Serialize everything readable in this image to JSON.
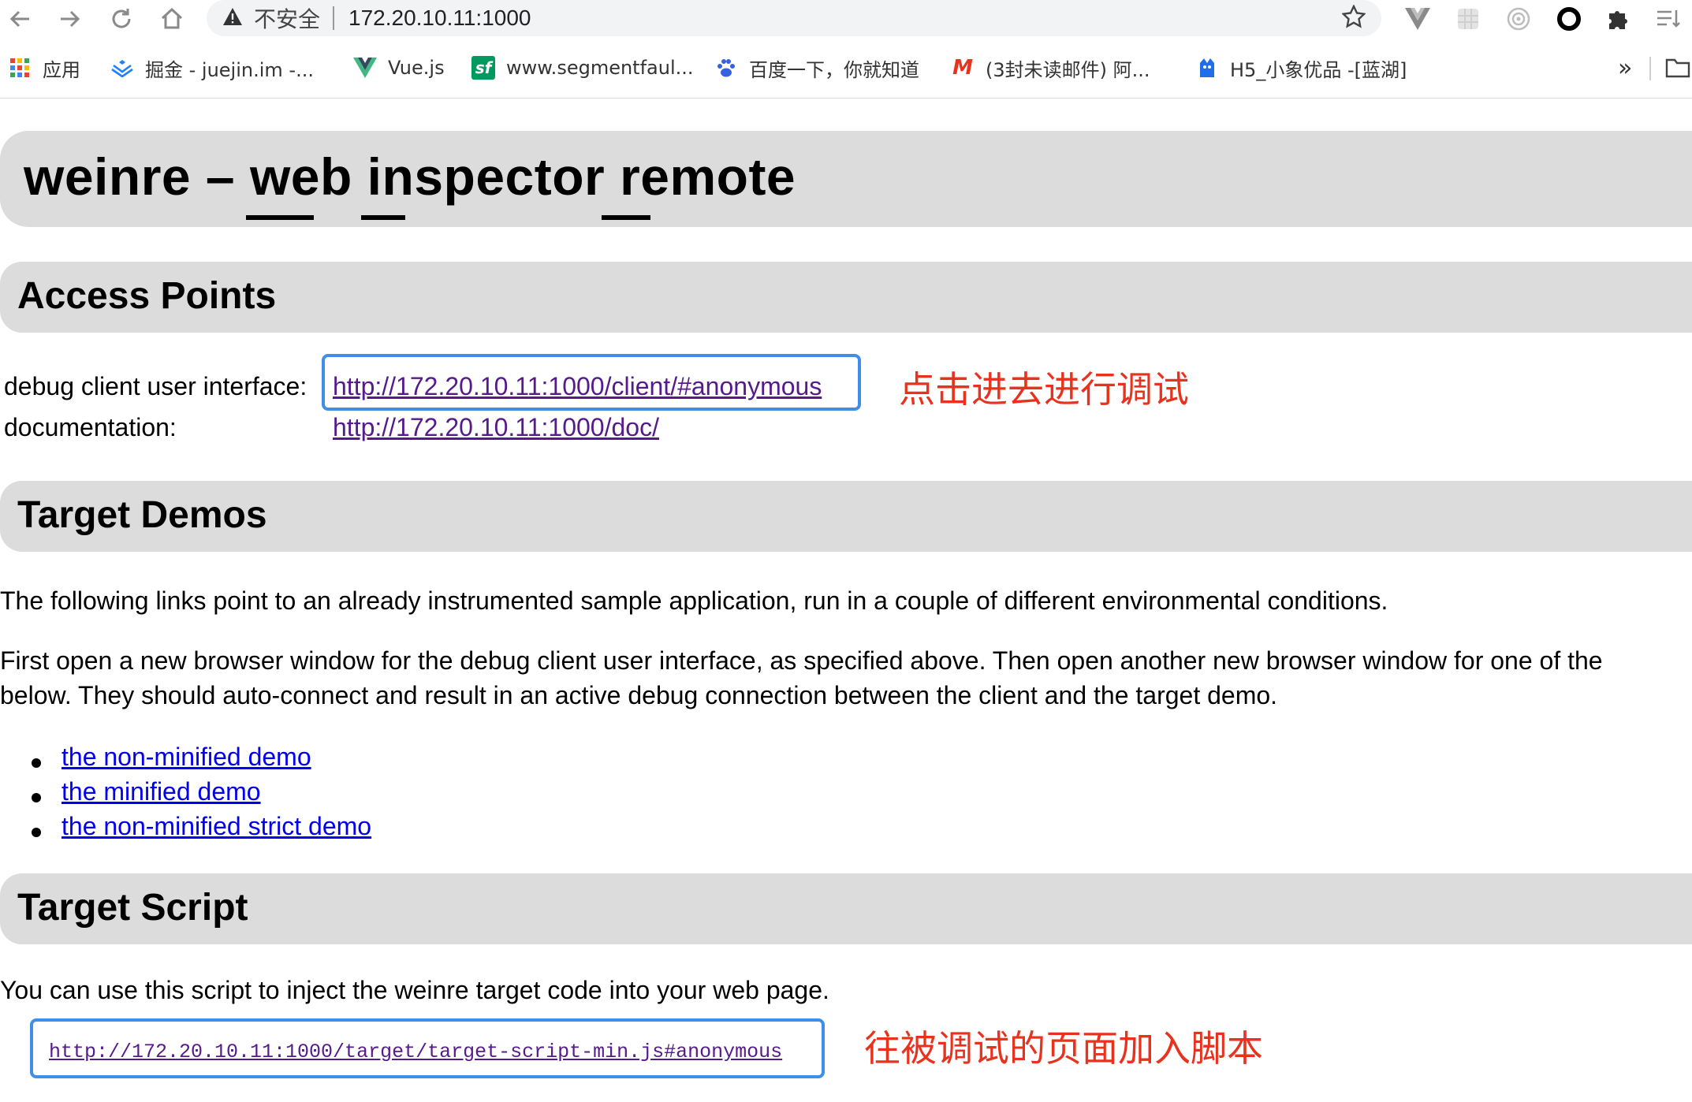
{
  "browser": {
    "security_label": "不安全",
    "url": "172.20.10.11:1000",
    "bookmarks": [
      {
        "label": "应用",
        "icon": "apps-grid-icon"
      },
      {
        "label": "掘金 - juejin.im -...",
        "icon": "juejin-icon"
      },
      {
        "label": "Vue.js",
        "icon": "vue-icon"
      },
      {
        "label": "www.segmentfaul...",
        "icon": "segmentfault-icon"
      },
      {
        "label": "百度一下，你就知道",
        "icon": "baidu-paw-icon"
      },
      {
        "label": "(3封未读邮件) 阿...",
        "icon": "mail-m-icon"
      },
      {
        "label": "H5_小象优品 -[蓝湖]",
        "icon": "lanhu-icon"
      }
    ],
    "more_label": "»",
    "sf_glyph": "sf",
    "mail_glyph": "M"
  },
  "page": {
    "title": "weinre – web inspector remote",
    "sections": {
      "access_points": "Access Points",
      "target_demos": "Target Demos",
      "target_script": "Target Script"
    },
    "access": {
      "debug_label": "debug client user interface:",
      "debug_link": "http://172.20.10.11:1000/client/#anonymous",
      "doc_label": "documentation:",
      "doc_link": "http://172.20.10.11:1000/doc/"
    },
    "demos": {
      "para1": "The following links point to an already instrumented sample application, run in a couple of different environmental conditions.",
      "para2_line1": "First open a new browser window for the debug client user interface, as specified above. Then open another new browser window for one of the",
      "para2_line2": "below. They should auto-connect and result in an active debug connection between the client and the target demo.",
      "links": [
        "the non-minified demo",
        "the minified demo",
        "the non-minified strict demo"
      ]
    },
    "script": {
      "para": "You can use this script to inject the weinre target code into your web page.",
      "link": "http://172.20.10.11:1000/target/target-script-min.js#anonymous"
    }
  },
  "annotations": {
    "click_to_debug": "点击进去进行调试",
    "add_script": "往被调试的页面加入脚本"
  },
  "colors": {
    "annotation_red": "#e8321e",
    "highlight_blue": "#3e8eea",
    "section_gray": "#dcdcdc",
    "visited_link": "#551a8b",
    "link_blue": "#0000ee"
  }
}
